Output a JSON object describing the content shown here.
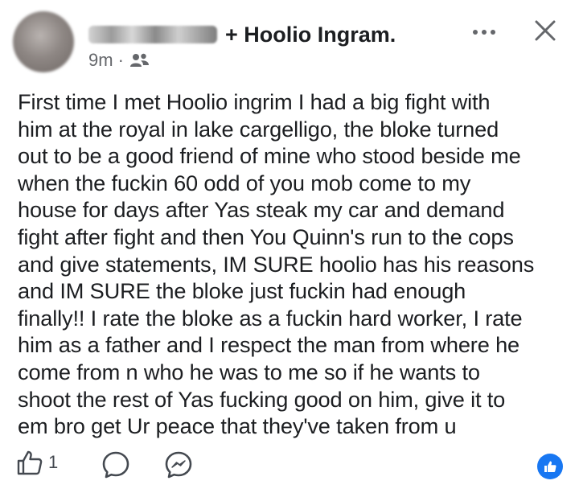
{
  "header": {
    "tagged_text": "+ Hoolio Ingram.",
    "timestamp": "9m",
    "separator": "·",
    "audience_icon": "friends-icon",
    "more_icon": "more-horizontal-icon",
    "close_icon": "close-icon"
  },
  "post": {
    "text": "First time I met Hoolio ingrim I had a big fight with\nhim at the royal in lake cargelligo, the bloke turned\nout to be  a good friend of mine who stood beside me\nwhen the fuckin 60 odd of you mob come to my\nhouse for days after Yas steak my car and demand\nfight after fight and then You Quinn's run to the cops\nand give statements, IM SURE hoolio has his reasons\nand IM SURE the bloke just fuckin had enough\nfinally!! I rate the bloke as a fuckin hard worker, I rate\nhim as a father and I respect the man from where he\ncome from n who he was to me so if he wants to\nshoot the rest of Yas fucking good on him, give it to\nem bro get Ur peace that they've taken from u"
  },
  "footer": {
    "like_icon": "thumbs-up-icon",
    "like_count": "1",
    "comment_icon": "comment-icon",
    "share_icon": "messenger-icon",
    "reaction_icon": "like-reaction-icon"
  },
  "colors": {
    "text": "#1c1e21",
    "secondary": "#65676b",
    "brand_blue": "#1877f2"
  }
}
